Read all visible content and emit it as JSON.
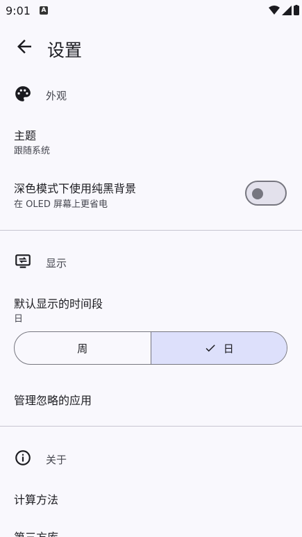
{
  "status_bar": {
    "time": "9:01",
    "notification_badge": "A",
    "icons": [
      "wifi-icon",
      "signal-icon",
      "battery-icon"
    ]
  },
  "app_bar": {
    "title": "设置"
  },
  "sections": {
    "appearance": {
      "label": "外观",
      "theme_title": "主题",
      "theme_value": "跟随系统",
      "oled_title": "深色模式下使用纯黑背景",
      "oled_subtitle": "在 OLED 屏幕上更省电",
      "oled_enabled": false
    },
    "display": {
      "label": "显示",
      "period_title": "默认显示的时间段",
      "period_value": "日",
      "options": [
        "周",
        "日"
      ],
      "selected_option": "日",
      "ignored_apps": "管理忽略的应用"
    },
    "about": {
      "label": "关于",
      "calc_method": "计算方法",
      "third_party": "第三方库"
    }
  },
  "colors": {
    "background": "#f9f8fd",
    "accent_selected": "#dde0fb",
    "outline": "#76767f"
  }
}
